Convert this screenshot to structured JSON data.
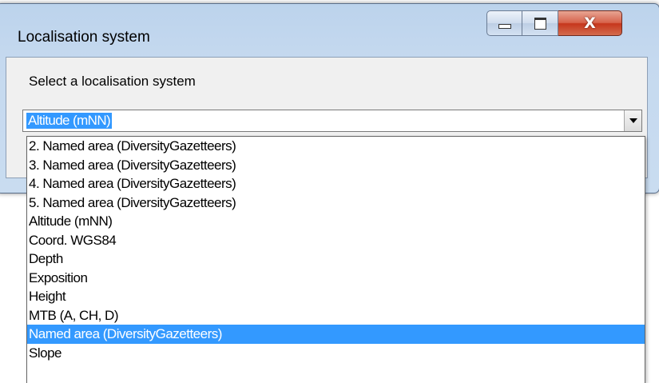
{
  "window": {
    "title": "Localisation system",
    "minimize_icon": "minimize-icon",
    "maximize_icon": "maximize-icon",
    "close_icon": "close-icon",
    "close_glyph": "X"
  },
  "form": {
    "prompt": "Select a localisation system",
    "combo_value": "Altitude (mNN)",
    "combo_arrow_icon": "chevron-down-icon"
  },
  "dropdown": {
    "options": [
      "2. Named area (DiversityGazetteers)",
      "3. Named area (DiversityGazetteers)",
      "4. Named area (DiversityGazetteers)",
      "5. Named area (DiversityGazetteers)",
      "Altitude (mNN)",
      "Coord. WGS84",
      "Depth",
      "Exposition",
      "Height",
      "MTB (A, CH, D)",
      "Named area (DiversityGazetteers)",
      "Slope"
    ],
    "highlighted": "Named area (DiversityGazetteers)",
    "highlight_color": "#3399ff"
  }
}
